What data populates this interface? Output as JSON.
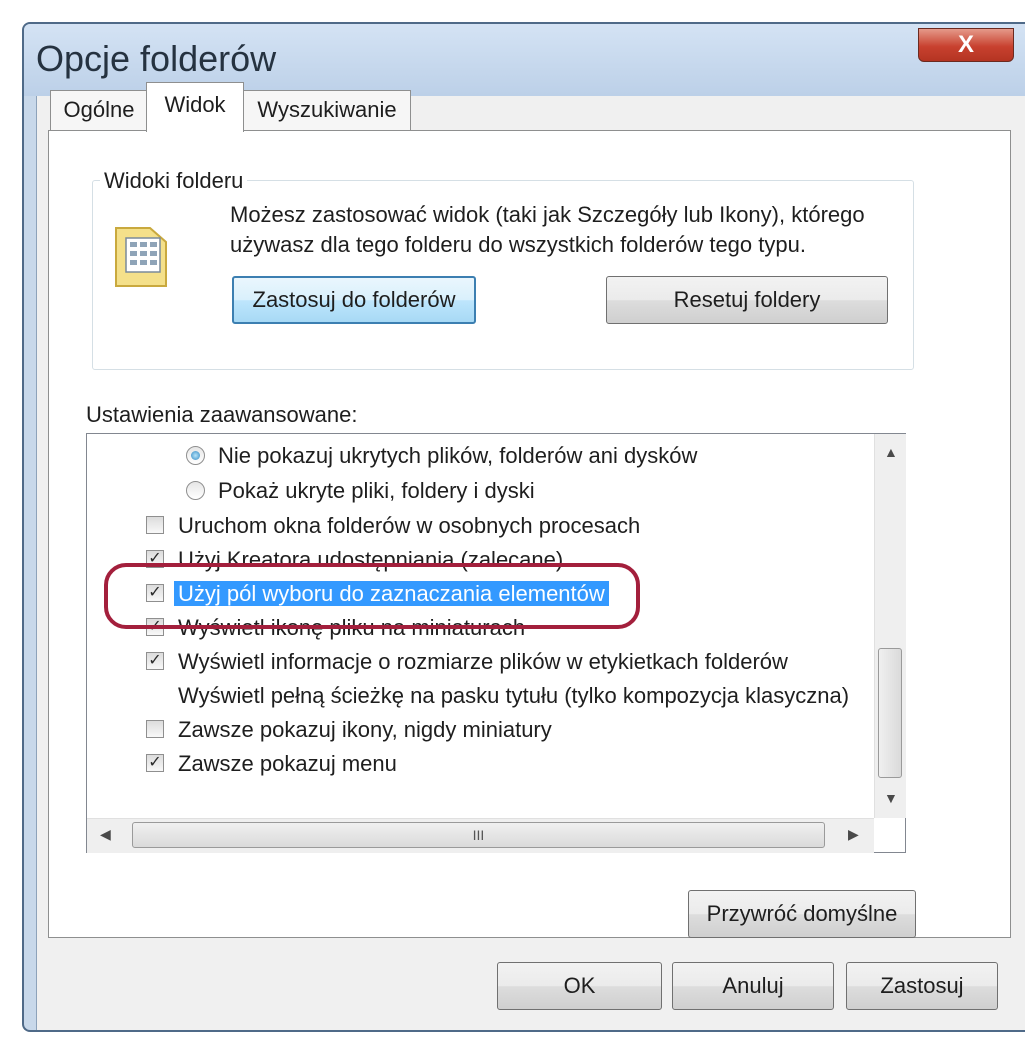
{
  "window": {
    "title": "Opcje folderów",
    "close_glyph": "X"
  },
  "tabs": [
    {
      "label": "Ogólne",
      "active": false
    },
    {
      "label": "Widok",
      "active": true
    },
    {
      "label": "Wyszukiwanie",
      "active": false
    }
  ],
  "folder_views": {
    "legend": "Widoki folderu",
    "description": "Możesz zastosować widok (taki jak Szczegóły lub Ikony), którego używasz dla tego folderu do wszystkich folderów tego typu.",
    "apply_button": "Zastosuj do folderów",
    "reset_button": "Resetuj foldery"
  },
  "advanced": {
    "label": "Ustawienia zaawansowane:",
    "items": [
      {
        "type": "radio",
        "checked": true,
        "label": "Nie pokazuj ukrytych plików, folderów ani dysków"
      },
      {
        "type": "radio",
        "checked": false,
        "label": "Pokaż ukryte pliki, foldery i dyski"
      },
      {
        "type": "checkbox",
        "checked": false,
        "label": "Uruchom okna folderów w osobnych procesach"
      },
      {
        "type": "checkbox",
        "checked": true,
        "label": "Użyj Kreatora udostępniania (zalecane)"
      },
      {
        "type": "checkbox",
        "checked": true,
        "selected": true,
        "label": "Użyj pól wyboru do zaznaczania elementów"
      },
      {
        "type": "checkbox",
        "checked": true,
        "label": "Wyświetl ikonę pliku na miniaturach"
      },
      {
        "type": "checkbox",
        "checked": true,
        "label": "Wyświetl informacje o rozmiarze plików w etykietkach folderów"
      },
      {
        "type": "checkbox",
        "checked": false,
        "label": "Wyświetl pełną ścieżkę na pasku tytułu (tylko kompozycja klasyczna)"
      },
      {
        "type": "checkbox",
        "checked": false,
        "label": "Zawsze pokazuj ikony, nigdy miniatury"
      },
      {
        "type": "checkbox",
        "checked": true,
        "label": "Zawsze pokazuj menu"
      }
    ],
    "hscroll_thumb_glyph": "III"
  },
  "restore_button": "Przywróć domyślne",
  "footer": {
    "ok": "OK",
    "cancel": "Anuluj",
    "apply": "Zastosuj"
  },
  "colors": {
    "highlight": "#3399ff",
    "annotation_oval": "#a31f3c",
    "close_button": "#c8412f"
  }
}
